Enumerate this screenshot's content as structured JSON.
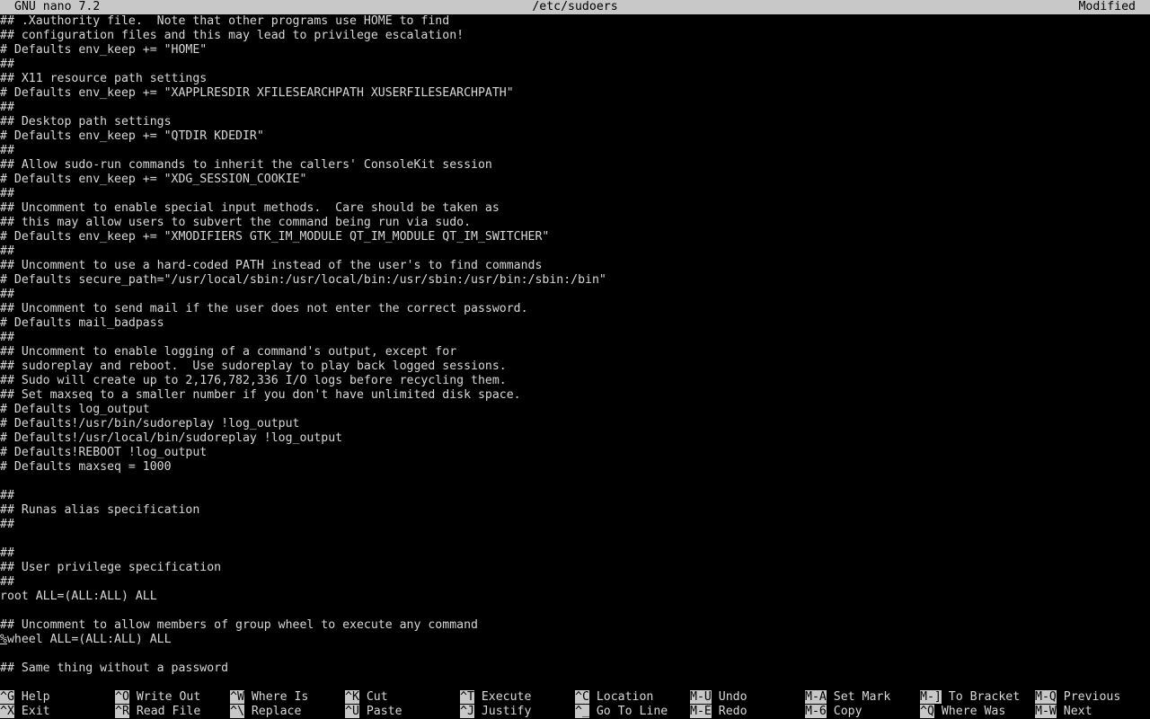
{
  "titlebar": {
    "app": "GNU nano 7.2",
    "file": "/etc/sudoers",
    "status": "Modified"
  },
  "editor": {
    "lines": [
      "## .Xauthority file.  Note that other programs use HOME to find",
      "## configuration files and this may lead to privilege escalation!",
      "# Defaults env_keep += \"HOME\"",
      "##",
      "## X11 resource path settings",
      "# Defaults env_keep += \"XAPPLRESDIR XFILESEARCHPATH XUSERFILESEARCHPATH\"",
      "##",
      "## Desktop path settings",
      "# Defaults env_keep += \"QTDIR KDEDIR\"",
      "##",
      "## Allow sudo-run commands to inherit the callers' ConsoleKit session",
      "# Defaults env_keep += \"XDG_SESSION_COOKIE\"",
      "##",
      "## Uncomment to enable special input methods.  Care should be taken as",
      "## this may allow users to subvert the command being run via sudo.",
      "# Defaults env_keep += \"XMODIFIERS GTK_IM_MODULE QT_IM_MODULE QT_IM_SWITCHER\"",
      "##",
      "## Uncomment to use a hard-coded PATH instead of the user's to find commands",
      "# Defaults secure_path=\"/usr/local/sbin:/usr/local/bin:/usr/sbin:/usr/bin:/sbin:/bin\"",
      "##",
      "## Uncomment to send mail if the user does not enter the correct password.",
      "# Defaults mail_badpass",
      "##",
      "## Uncomment to enable logging of a command's output, except for",
      "## sudoreplay and reboot.  Use sudoreplay to play back logged sessions.",
      "## Sudo will create up to 2,176,782,336 I/O logs before recycling them.",
      "## Set maxseq to a smaller number if you don't have unlimited disk space.",
      "# Defaults log_output",
      "# Defaults!/usr/bin/sudoreplay !log_output",
      "# Defaults!/usr/local/bin/sudoreplay !log_output",
      "# Defaults!REBOOT !log_output",
      "# Defaults maxseq = 1000",
      "",
      "##",
      "## Runas alias specification",
      "##",
      "",
      "##",
      "## User privilege specification",
      "##",
      "root ALL=(ALL:ALL) ALL",
      "",
      "## Uncomment to allow members of group wheel to execute any command",
      "%wheel ALL=(ALL:ALL) ALL",
      "",
      "## Same thing without a password"
    ]
  },
  "shortcuts": [
    {
      "key": "^G",
      "label": "Help"
    },
    {
      "key": "^X",
      "label": "Exit"
    },
    {
      "key": "^O",
      "label": "Write Out"
    },
    {
      "key": "^R",
      "label": "Read File"
    },
    {
      "key": "^W",
      "label": "Where Is"
    },
    {
      "key": "^\\",
      "label": "Replace"
    },
    {
      "key": "^K",
      "label": "Cut"
    },
    {
      "key": "^U",
      "label": "Paste"
    },
    {
      "key": "^T",
      "label": "Execute"
    },
    {
      "key": "^J",
      "label": "Justify"
    },
    {
      "key": "^C",
      "label": "Location"
    },
    {
      "key": "^_",
      "label": "Go To Line"
    },
    {
      "key": "M-U",
      "label": "Undo"
    },
    {
      "key": "M-E",
      "label": "Redo"
    },
    {
      "key": "M-A",
      "label": "Set Mark"
    },
    {
      "key": "M-6",
      "label": "Copy"
    },
    {
      "key": "M-]",
      "label": "To Bracket"
    },
    {
      "key": "^Q",
      "label": "Where Was"
    },
    {
      "key": "M-Q",
      "label": "Previous"
    },
    {
      "key": "M-W",
      "label": "Next"
    }
  ]
}
